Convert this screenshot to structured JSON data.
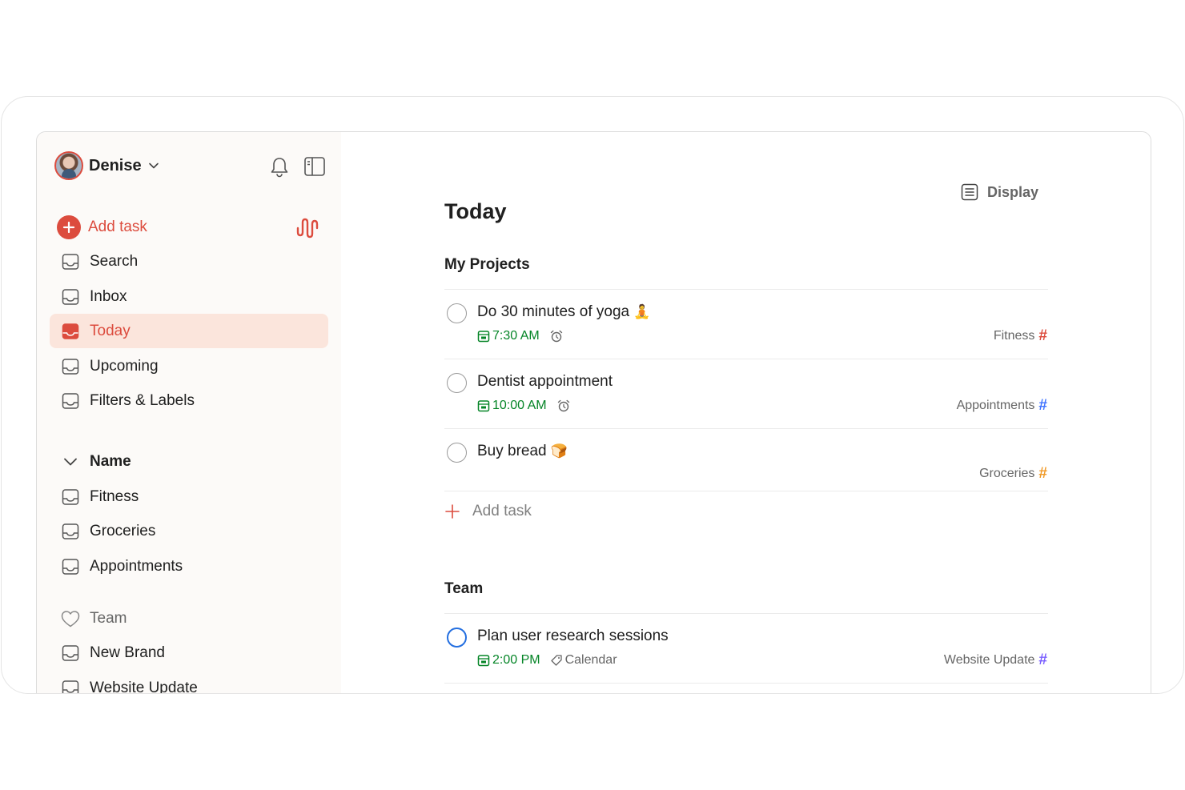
{
  "user": {
    "name": "Denise"
  },
  "sidebar": {
    "add_task": "Add task",
    "items": [
      {
        "label": "Search"
      },
      {
        "label": "Inbox"
      },
      {
        "label": "Today"
      },
      {
        "label": "Upcoming"
      },
      {
        "label": "Filters & Labels"
      }
    ],
    "section": {
      "title": "Name",
      "projects": [
        {
          "label": "Fitness"
        },
        {
          "label": "Groceries"
        },
        {
          "label": "Appointments"
        }
      ]
    },
    "team": {
      "title": "Team",
      "projects": [
        {
          "label": "New Brand"
        },
        {
          "label": "Website Update"
        }
      ]
    }
  },
  "main": {
    "display_label": "Display",
    "title": "Today",
    "groups": [
      {
        "title": "My Projects",
        "tasks": [
          {
            "title": "Do 30 minutes of yoga",
            "emoji": "🧘",
            "time": "7:30 AM",
            "project": "Fitness",
            "project_color": "#dc4c3e"
          },
          {
            "title": "Dentist appointment",
            "time": "10:00 AM",
            "project": "Appointments",
            "project_color": "#4073ff"
          },
          {
            "title": "Buy bread",
            "emoji": "🍞",
            "project": "Groceries",
            "project_color": "#f09a28"
          }
        ],
        "add_task": "Add task"
      },
      {
        "title": "Team",
        "tasks": [
          {
            "title": "Plan user research sessions",
            "time": "2:00 PM",
            "label": "Calendar",
            "project": "Website Update",
            "project_color": "#7a5fff"
          }
        ]
      }
    ]
  },
  "colors": {
    "accent": "#dc4c3e",
    "date_green": "#058527",
    "active_bg": "#fbe5dc",
    "sidebar_bg": "#fcfaf8"
  }
}
